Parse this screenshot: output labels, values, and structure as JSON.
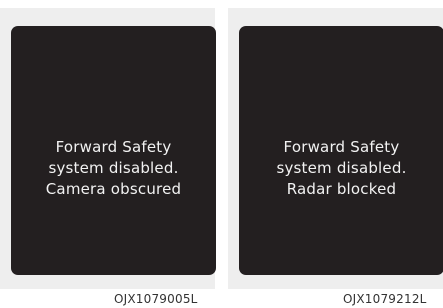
{
  "panels": [
    {
      "lines": [
        "Forward Safety",
        "system disabled.",
        "Camera obscured"
      ],
      "code": "OJX1079005L"
    },
    {
      "lines": [
        "Forward Safety",
        "system disabled.",
        "Radar blocked"
      ],
      "code": "OJX1079212L"
    }
  ],
  "colors": {
    "screen_background": "#231f20",
    "panel_background": "#eeeeee",
    "message_text": "#f2f2f2"
  }
}
